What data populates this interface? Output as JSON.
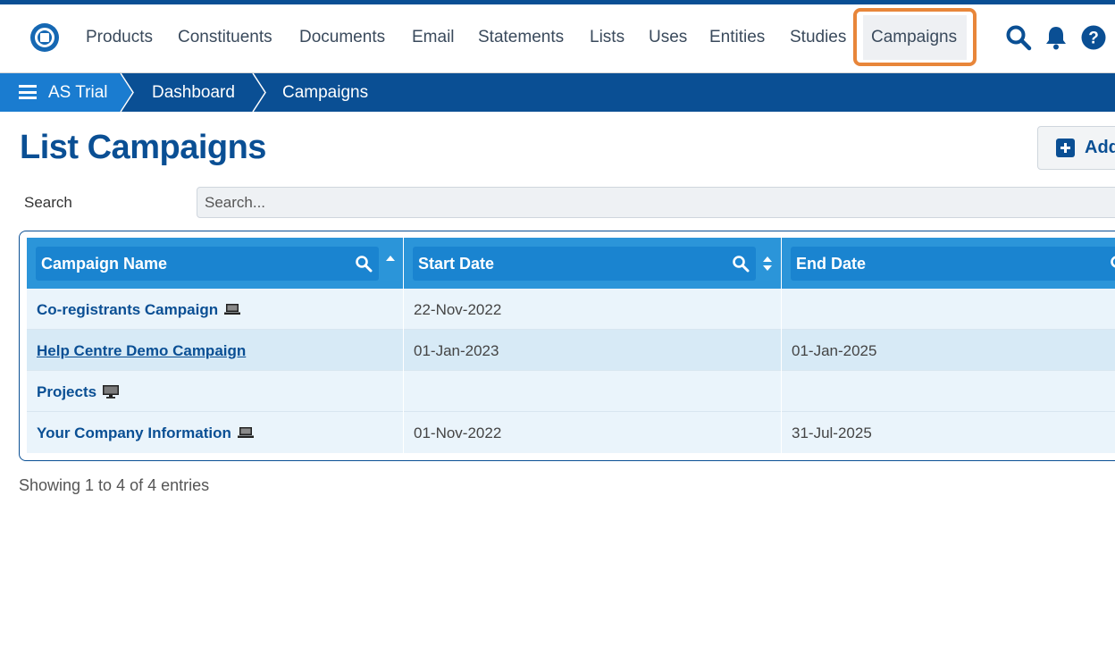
{
  "nav": {
    "items": [
      "Products",
      "Constituents",
      "Documents",
      "Email",
      "Statements",
      "Lists",
      "Uses",
      "Entities",
      "Studies"
    ],
    "active": "Campaigns",
    "icons": [
      "search-icon",
      "bell-icon",
      "help-icon"
    ]
  },
  "breadcrumb": {
    "items": [
      "AS Trial",
      "Dashboard",
      "Campaigns"
    ]
  },
  "page": {
    "title": "List Campaigns",
    "add_label": "Add"
  },
  "search": {
    "label": "Search",
    "placeholder": "Search..."
  },
  "table": {
    "columns": [
      "Campaign Name",
      "Start Date",
      "End Date"
    ],
    "rows": [
      {
        "name": "Co-registrants Campaign",
        "start": "22-Nov-2022",
        "end": "",
        "icon": "laptop-icon"
      },
      {
        "name": "Help Centre Demo Campaign",
        "start": "01-Jan-2023",
        "end": "01-Jan-2025",
        "icon": ""
      },
      {
        "name": "Projects",
        "start": "",
        "end": "",
        "icon": "monitor-icon"
      },
      {
        "name": "Your Company Information",
        "start": "01-Nov-2022",
        "end": "31-Jul-2025",
        "icon": "laptop-icon"
      }
    ],
    "info": "Showing 1 to 4 of 4 entries"
  },
  "colors": {
    "brand": "#0a4f94",
    "header": "#2b95d9",
    "highlight": "#e8863a"
  }
}
